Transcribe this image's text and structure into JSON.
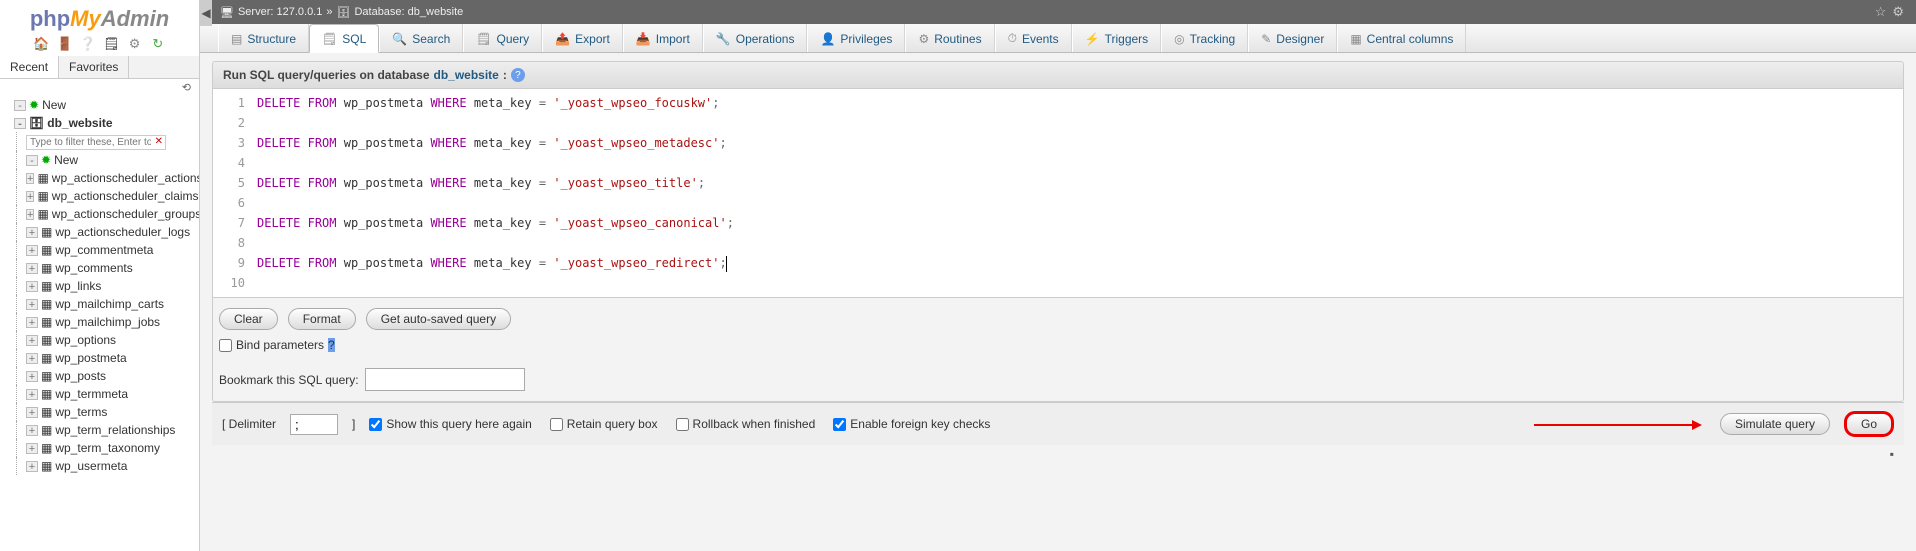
{
  "logo": {
    "p1": "php",
    "p2": "My",
    "p3": "Admin"
  },
  "sidebar_tabs": {
    "recent": "Recent",
    "favorites": "Favorites"
  },
  "tree": {
    "new_top": "New",
    "database": "db_website",
    "filter_placeholder": "Type to filter these, Enter to sear",
    "new_table": "New",
    "tables": [
      "wp_actionscheduler_actions",
      "wp_actionscheduler_claims",
      "wp_actionscheduler_groups",
      "wp_actionscheduler_logs",
      "wp_commentmeta",
      "wp_comments",
      "wp_links",
      "wp_mailchimp_carts",
      "wp_mailchimp_jobs",
      "wp_options",
      "wp_postmeta",
      "wp_posts",
      "wp_termmeta",
      "wp_terms",
      "wp_term_relationships",
      "wp_term_taxonomy",
      "wp_usermeta"
    ]
  },
  "breadcrumb": {
    "server_label": "Server: 127.0.0.1",
    "sep": "»",
    "db_label": "Database: db_website"
  },
  "tabs": [
    {
      "icon": "▤",
      "label": "Structure"
    },
    {
      "icon": "🗒",
      "label": "SQL"
    },
    {
      "icon": "🔍",
      "label": "Search"
    },
    {
      "icon": "🗒",
      "label": "Query"
    },
    {
      "icon": "📤",
      "label": "Export"
    },
    {
      "icon": "📥",
      "label": "Import"
    },
    {
      "icon": "🔧",
      "label": "Operations"
    },
    {
      "icon": "👤",
      "label": "Privileges"
    },
    {
      "icon": "⚙",
      "label": "Routines"
    },
    {
      "icon": "⏱",
      "label": "Events"
    },
    {
      "icon": "⚡",
      "label": "Triggers"
    },
    {
      "icon": "◎",
      "label": "Tracking"
    },
    {
      "icon": "✎",
      "label": "Designer"
    },
    {
      "icon": "▦",
      "label": "Central columns"
    }
  ],
  "panel": {
    "title_prefix": "Run SQL query/queries on database",
    "db": "db_website",
    "colon": ":"
  },
  "sql_lines": [
    {
      "tokens": [
        [
          "kw1",
          "DELETE"
        ],
        [
          "sp",
          " "
        ],
        [
          "kw1",
          "FROM"
        ],
        [
          "sp",
          " "
        ],
        [
          "id",
          "wp_postmeta"
        ],
        [
          "sp",
          " "
        ],
        [
          "kw1",
          "WHERE"
        ],
        [
          "sp",
          " "
        ],
        [
          "id",
          "meta_key"
        ],
        [
          "sp",
          " "
        ],
        [
          "op",
          "="
        ],
        [
          "sp",
          " "
        ],
        [
          "str",
          "'_yoast_wpseo_focuskw'"
        ],
        [
          "op",
          ";"
        ]
      ]
    },
    {
      "tokens": []
    },
    {
      "tokens": [
        [
          "kw1",
          "DELETE"
        ],
        [
          "sp",
          " "
        ],
        [
          "kw1",
          "FROM"
        ],
        [
          "sp",
          " "
        ],
        [
          "id",
          "wp_postmeta"
        ],
        [
          "sp",
          " "
        ],
        [
          "kw1",
          "WHERE"
        ],
        [
          "sp",
          " "
        ],
        [
          "id",
          "meta_key"
        ],
        [
          "sp",
          " "
        ],
        [
          "op",
          "="
        ],
        [
          "sp",
          " "
        ],
        [
          "str",
          "'_yoast_wpseo_metadesc'"
        ],
        [
          "op",
          ";"
        ]
      ]
    },
    {
      "tokens": []
    },
    {
      "tokens": [
        [
          "kw1",
          "DELETE"
        ],
        [
          "sp",
          " "
        ],
        [
          "kw1",
          "FROM"
        ],
        [
          "sp",
          " "
        ],
        [
          "id",
          "wp_postmeta"
        ],
        [
          "sp",
          " "
        ],
        [
          "kw1",
          "WHERE"
        ],
        [
          "sp",
          " "
        ],
        [
          "id",
          "meta_key"
        ],
        [
          "sp",
          " "
        ],
        [
          "op",
          "="
        ],
        [
          "sp",
          " "
        ],
        [
          "str",
          "'_yoast_wpseo_title'"
        ],
        [
          "op",
          ";"
        ]
      ]
    },
    {
      "tokens": []
    },
    {
      "tokens": [
        [
          "kw1",
          "DELETE"
        ],
        [
          "sp",
          " "
        ],
        [
          "kw1",
          "FROM"
        ],
        [
          "sp",
          " "
        ],
        [
          "id",
          "wp_postmeta"
        ],
        [
          "sp",
          " "
        ],
        [
          "kw1",
          "WHERE"
        ],
        [
          "sp",
          " "
        ],
        [
          "id",
          "meta_key"
        ],
        [
          "sp",
          " "
        ],
        [
          "op",
          "="
        ],
        [
          "sp",
          " "
        ],
        [
          "str",
          "'_yoast_wpseo_canonical'"
        ],
        [
          "op",
          ";"
        ]
      ]
    },
    {
      "tokens": []
    },
    {
      "tokens": [
        [
          "kw1",
          "DELETE"
        ],
        [
          "sp",
          " "
        ],
        [
          "kw1",
          "FROM"
        ],
        [
          "sp",
          " "
        ],
        [
          "id",
          "wp_postmeta"
        ],
        [
          "sp",
          " "
        ],
        [
          "kw1",
          "WHERE"
        ],
        [
          "sp",
          " "
        ],
        [
          "id",
          "meta_key"
        ],
        [
          "sp",
          " "
        ],
        [
          "op",
          "="
        ],
        [
          "sp",
          " "
        ],
        [
          "str",
          "'_yoast_wpseo_redirect'"
        ],
        [
          "op",
          ";"
        ],
        [
          "cursor",
          ""
        ]
      ]
    },
    {
      "tokens": []
    }
  ],
  "buttons": {
    "clear": "Clear",
    "format": "Format",
    "autosaved": "Get auto-saved query"
  },
  "bind_params": "Bind parameters",
  "bookmark_label": "Bookmark this SQL query:",
  "footer": {
    "delimiter_label": "[ Delimiter",
    "delimiter_value": ";",
    "delimiter_close": "]",
    "show_again": "Show this query here again",
    "retain": "Retain query box",
    "rollback": "Rollback when finished",
    "fk": "Enable foreign key checks",
    "simulate": "Simulate query",
    "go": "Go"
  }
}
